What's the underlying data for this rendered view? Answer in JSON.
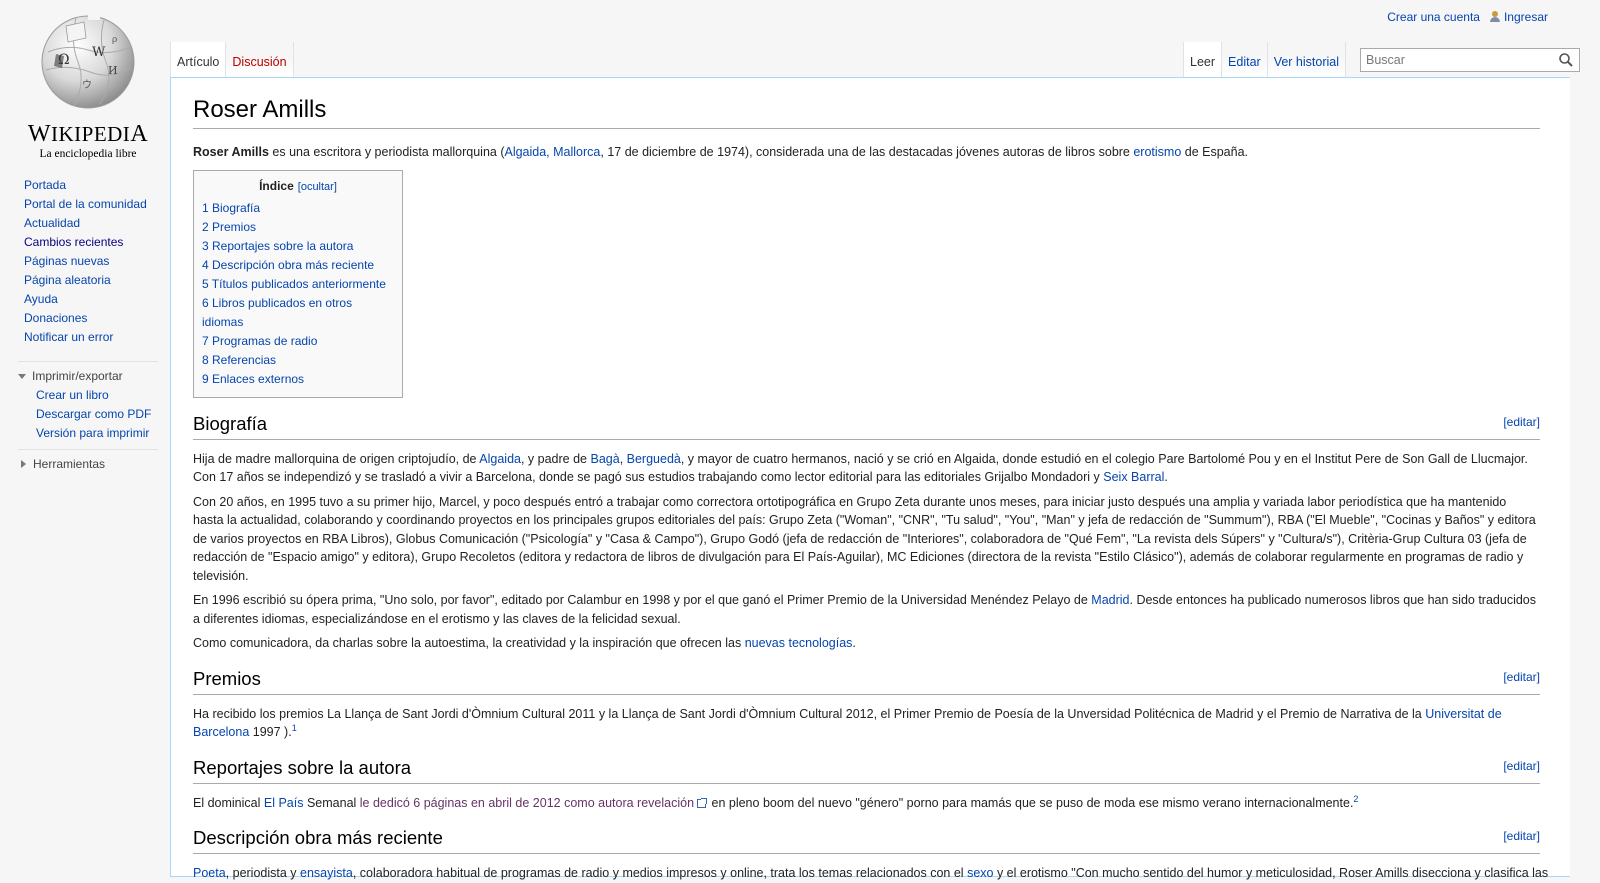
{
  "logo": {
    "wordmark_cap1": "W",
    "wordmark_mid": "IKIPEDI",
    "wordmark_cap2": "A",
    "tagline": "La enciclopedia libre"
  },
  "personal": {
    "create_account": "Crear una cuenta",
    "login": "Ingresar"
  },
  "tabs": {
    "article": "Artículo",
    "discussion": "Discusión",
    "read": "Leer",
    "edit": "Editar",
    "history": "Ver historial"
  },
  "search": {
    "placeholder": "Buscar"
  },
  "nav": [
    "Portada",
    "Portal de la comunidad",
    "Actualidad",
    "Cambios recientes",
    "Páginas nuevas",
    "Página aleatoria",
    "Ayuda",
    "Donaciones",
    "Notificar un error"
  ],
  "print": {
    "title": "Imprimir/exportar",
    "items": [
      "Crear un libro",
      "Descargar como PDF",
      "Versión para imprimir"
    ]
  },
  "tools": {
    "title": "Herramientas"
  },
  "article": {
    "title": "Roser Amills",
    "intro": {
      "bold": "Roser Amills",
      "t1": " es una escritora y periodista mallorquina (",
      "l1": "Algaida, Mallorca",
      "t2": ", 17 de diciembre de 1974), considerada una de las destacadas jóvenes autoras de libros sobre ",
      "l2": "erotismo",
      "t3": " de España."
    },
    "toc": {
      "title": "Índice",
      "toggle": "[ocultar]",
      "items": [
        "1 Biografía",
        "2 Premios",
        "3 Reportajes sobre la autora",
        "4 Descripción obra más reciente",
        "5 Títulos publicados anteriormente",
        "6 Libros publicados en otros idiomas",
        "7 Programas de radio",
        "8 Referencias",
        "9 Enlaces externos"
      ]
    },
    "edit_label": "[editar]",
    "bio": {
      "heading": "Biografía",
      "p1": {
        "t1": "Hija de madre mallorquina de origen criptojudío, de ",
        "l1": "Algaida",
        "t2": ", y padre de ",
        "l2": "Bagà",
        "t3": ", ",
        "l3": "Berguedà",
        "t4": ", y mayor de cuatro hermanos, nació y se crió en Algaida, donde estudió en el colegio Pare Bartolomé Pou y en el Institut Pere de Son Gall de Llucmajor. Con 17 años se independizó y se trasladó a vivir a Barcelona, donde se pagó sus estudios trabajando como lector editorial para las editoriales Grijalbo Mondadori y ",
        "l4": "Seix Barral",
        "t5": "."
      },
      "p2": "Con 20 años, en 1995 tuvo a su primer hijo, Marcel, y poco después entró a trabajar como correctora ortotipográfica en Grupo Zeta durante unos meses, para iniciar justo después una amplia y variada labor periodística que ha mantenido hasta la actualidad, colaborando y coordinando proyectos en los principales grupos editoriales del país: Grupo Zeta (\"Woman\", \"CNR\", \"Tu salud\", \"You\", \"Man\" y jefa de redacción de \"Summum\"), RBA (\"El Mueble\", \"Cocinas y Baños\" y editora de varios proyectos en RBA Libros), Globus Comunicación (\"Psicología\" y \"Casa & Campo\"), Grupo Godó (jefa de redacción de \"Interiores\", colaboradora de \"Qué Fem\", \"La revista dels Súpers\" y \"Cultura/s\"), Critèria-Grup Cultura 03 (jefa de redacción de \"Espacio amigo\" y editora), Grupo Recoletos (editora y redactora de libros de divulgación para El País-Aguilar), MC Ediciones (directora de la revista \"Estilo Clásico\"), además de colaborar regularmente en programas de radio y televisión.",
      "p3": {
        "t1": "En 1996 escribió su ópera prima, \"Uno solo, por favor\", editado por Calambur en 1998 y por el que ganó el Primer Premio de la Universidad Menéndez Pelayo de ",
        "l1": "Madrid",
        "t2": ". Desde entonces ha publicado numerosos libros que han sido traducidos a diferentes idiomas, especializándose en el erotismo y las claves de la felicidad sexual."
      },
      "p4": {
        "t1": "Como comunicadora, da charlas sobre la autoestima, la creatividad y la inspiración que ofrecen las ",
        "l1": "nuevas tecnologías",
        "t2": "."
      }
    },
    "awards": {
      "heading": "Premios",
      "t1": "Ha recibido los premios La Llança de Sant Jordi d'Òmnium Cultural 2011 y la Llança de Sant Jordi d'Òmnium Cultural 2012, el Primer Premio de Poesía de la Unversidad Politécnica de Madrid y el Premio de Narrativa de la ",
      "l1": "Universitat de Barcelona",
      "t2": " 1997 ).",
      "ref": "1"
    },
    "reports": {
      "heading": "Reportajes sobre la autora",
      "t1": "El dominical ",
      "l1": "El País",
      "t2": " Semanal ",
      "l2": "le dedicó 6 páginas en abril de 2012 como autora revelación",
      "t3": " en pleno boom del nuevo \"género\" porno para mamás que se puso de moda ese mismo verano internacionalmente.",
      "ref": "2"
    },
    "recent": {
      "heading": "Descripción obra más reciente",
      "l1": "Poeta",
      "t1": ", periodista y ",
      "l2": "ensayista",
      "t2": ", colaboradora habitual de programas de radio y medios impresos y online, trata los temas relacionados con el ",
      "l3": "sexo",
      "t3": " y el erotismo \"Con mucho sentido del humor y meticulosidad, Roser Amills disecciona y clasifica las"
    }
  }
}
